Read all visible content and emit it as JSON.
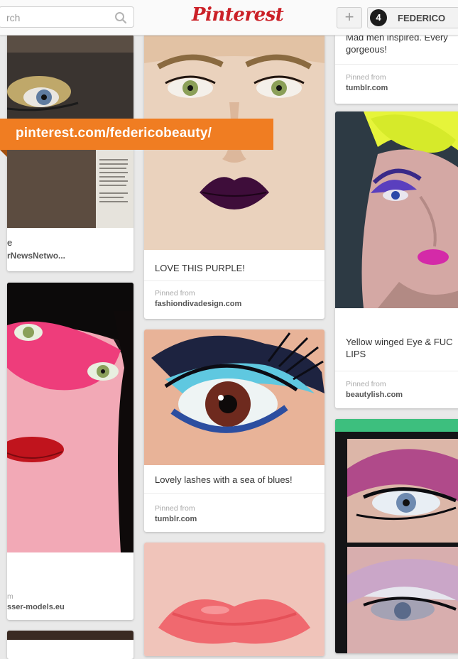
{
  "header": {
    "search_placeholder": "rch",
    "logo": "Pinterest",
    "add_label": "+",
    "avatar_initial": "4",
    "profile_name": "FEDERICO"
  },
  "banner": {
    "text": "pinterest.com/federicobeauty/"
  },
  "pins": {
    "col1_top": {
      "desc": "e",
      "pinned_from": "",
      "source": "rNewsNetwo..."
    },
    "col1_mid": {
      "pinned_from": "m",
      "source": "sser-models.eu"
    },
    "col2_top": {
      "desc": "LOVE THIS PURPLE!",
      "pinned_from": "Pinned from",
      "source": "fashiondivadesign.com"
    },
    "col2_mid": {
      "desc": "Lovely lashes with a sea of blues!",
      "pinned_from": "Pinned from",
      "source": "tumblr.com"
    },
    "col3_top": {
      "desc": "Mad men inspired. Every gorgeous!",
      "pinned_from": "Pinned from",
      "source": "tumblr.com"
    },
    "col3_mid": {
      "desc": "Yellow winged Eye & FUC LIPS",
      "pinned_from": "Pinned from",
      "source": "beautylish.com"
    }
  },
  "colors": {
    "brand_red": "#cb2027",
    "banner_orange": "#f07d22"
  }
}
